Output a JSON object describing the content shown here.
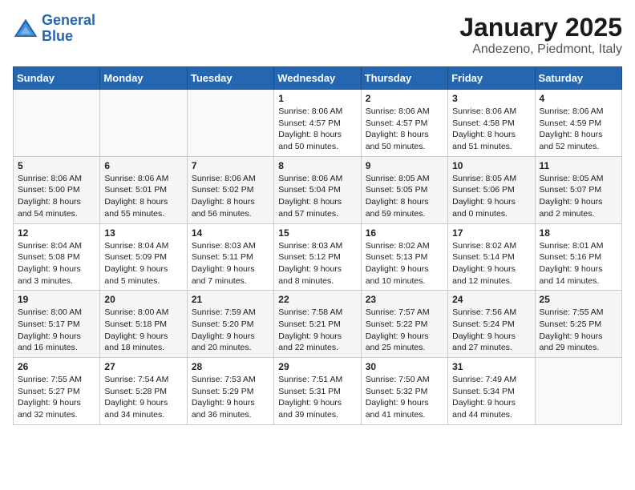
{
  "logo": {
    "line1": "General",
    "line2": "Blue"
  },
  "title": "January 2025",
  "subtitle": "Andezeno, Piedmont, Italy",
  "days_of_week": [
    "Sunday",
    "Monday",
    "Tuesday",
    "Wednesday",
    "Thursday",
    "Friday",
    "Saturday"
  ],
  "weeks": [
    [
      {
        "day": "",
        "info": ""
      },
      {
        "day": "",
        "info": ""
      },
      {
        "day": "",
        "info": ""
      },
      {
        "day": "1",
        "sunrise": "Sunrise: 8:06 AM",
        "sunset": "Sunset: 4:57 PM",
        "daylight": "Daylight: 8 hours and 50 minutes."
      },
      {
        "day": "2",
        "sunrise": "Sunrise: 8:06 AM",
        "sunset": "Sunset: 4:57 PM",
        "daylight": "Daylight: 8 hours and 50 minutes."
      },
      {
        "day": "3",
        "sunrise": "Sunrise: 8:06 AM",
        "sunset": "Sunset: 4:58 PM",
        "daylight": "Daylight: 8 hours and 51 minutes."
      },
      {
        "day": "4",
        "sunrise": "Sunrise: 8:06 AM",
        "sunset": "Sunset: 4:59 PM",
        "daylight": "Daylight: 8 hours and 52 minutes."
      }
    ],
    [
      {
        "day": "5",
        "sunrise": "Sunrise: 8:06 AM",
        "sunset": "Sunset: 5:00 PM",
        "daylight": "Daylight: 8 hours and 54 minutes."
      },
      {
        "day": "6",
        "sunrise": "Sunrise: 8:06 AM",
        "sunset": "Sunset: 5:01 PM",
        "daylight": "Daylight: 8 hours and 55 minutes."
      },
      {
        "day": "7",
        "sunrise": "Sunrise: 8:06 AM",
        "sunset": "Sunset: 5:02 PM",
        "daylight": "Daylight: 8 hours and 56 minutes."
      },
      {
        "day": "8",
        "sunrise": "Sunrise: 8:06 AM",
        "sunset": "Sunset: 5:04 PM",
        "daylight": "Daylight: 8 hours and 57 minutes."
      },
      {
        "day": "9",
        "sunrise": "Sunrise: 8:05 AM",
        "sunset": "Sunset: 5:05 PM",
        "daylight": "Daylight: 8 hours and 59 minutes."
      },
      {
        "day": "10",
        "sunrise": "Sunrise: 8:05 AM",
        "sunset": "Sunset: 5:06 PM",
        "daylight": "Daylight: 9 hours and 0 minutes."
      },
      {
        "day": "11",
        "sunrise": "Sunrise: 8:05 AM",
        "sunset": "Sunset: 5:07 PM",
        "daylight": "Daylight: 9 hours and 2 minutes."
      }
    ],
    [
      {
        "day": "12",
        "sunrise": "Sunrise: 8:04 AM",
        "sunset": "Sunset: 5:08 PM",
        "daylight": "Daylight: 9 hours and 3 minutes."
      },
      {
        "day": "13",
        "sunrise": "Sunrise: 8:04 AM",
        "sunset": "Sunset: 5:09 PM",
        "daylight": "Daylight: 9 hours and 5 minutes."
      },
      {
        "day": "14",
        "sunrise": "Sunrise: 8:03 AM",
        "sunset": "Sunset: 5:11 PM",
        "daylight": "Daylight: 9 hours and 7 minutes."
      },
      {
        "day": "15",
        "sunrise": "Sunrise: 8:03 AM",
        "sunset": "Sunset: 5:12 PM",
        "daylight": "Daylight: 9 hours and 8 minutes."
      },
      {
        "day": "16",
        "sunrise": "Sunrise: 8:02 AM",
        "sunset": "Sunset: 5:13 PM",
        "daylight": "Daylight: 9 hours and 10 minutes."
      },
      {
        "day": "17",
        "sunrise": "Sunrise: 8:02 AM",
        "sunset": "Sunset: 5:14 PM",
        "daylight": "Daylight: 9 hours and 12 minutes."
      },
      {
        "day": "18",
        "sunrise": "Sunrise: 8:01 AM",
        "sunset": "Sunset: 5:16 PM",
        "daylight": "Daylight: 9 hours and 14 minutes."
      }
    ],
    [
      {
        "day": "19",
        "sunrise": "Sunrise: 8:00 AM",
        "sunset": "Sunset: 5:17 PM",
        "daylight": "Daylight: 9 hours and 16 minutes."
      },
      {
        "day": "20",
        "sunrise": "Sunrise: 8:00 AM",
        "sunset": "Sunset: 5:18 PM",
        "daylight": "Daylight: 9 hours and 18 minutes."
      },
      {
        "day": "21",
        "sunrise": "Sunrise: 7:59 AM",
        "sunset": "Sunset: 5:20 PM",
        "daylight": "Daylight: 9 hours and 20 minutes."
      },
      {
        "day": "22",
        "sunrise": "Sunrise: 7:58 AM",
        "sunset": "Sunset: 5:21 PM",
        "daylight": "Daylight: 9 hours and 22 minutes."
      },
      {
        "day": "23",
        "sunrise": "Sunrise: 7:57 AM",
        "sunset": "Sunset: 5:22 PM",
        "daylight": "Daylight: 9 hours and 25 minutes."
      },
      {
        "day": "24",
        "sunrise": "Sunrise: 7:56 AM",
        "sunset": "Sunset: 5:24 PM",
        "daylight": "Daylight: 9 hours and 27 minutes."
      },
      {
        "day": "25",
        "sunrise": "Sunrise: 7:55 AM",
        "sunset": "Sunset: 5:25 PM",
        "daylight": "Daylight: 9 hours and 29 minutes."
      }
    ],
    [
      {
        "day": "26",
        "sunrise": "Sunrise: 7:55 AM",
        "sunset": "Sunset: 5:27 PM",
        "daylight": "Daylight: 9 hours and 32 minutes."
      },
      {
        "day": "27",
        "sunrise": "Sunrise: 7:54 AM",
        "sunset": "Sunset: 5:28 PM",
        "daylight": "Daylight: 9 hours and 34 minutes."
      },
      {
        "day": "28",
        "sunrise": "Sunrise: 7:53 AM",
        "sunset": "Sunset: 5:29 PM",
        "daylight": "Daylight: 9 hours and 36 minutes."
      },
      {
        "day": "29",
        "sunrise": "Sunrise: 7:51 AM",
        "sunset": "Sunset: 5:31 PM",
        "daylight": "Daylight: 9 hours and 39 minutes."
      },
      {
        "day": "30",
        "sunrise": "Sunrise: 7:50 AM",
        "sunset": "Sunset: 5:32 PM",
        "daylight": "Daylight: 9 hours and 41 minutes."
      },
      {
        "day": "31",
        "sunrise": "Sunrise: 7:49 AM",
        "sunset": "Sunset: 5:34 PM",
        "daylight": "Daylight: 9 hours and 44 minutes."
      },
      {
        "day": "",
        "info": ""
      }
    ]
  ]
}
